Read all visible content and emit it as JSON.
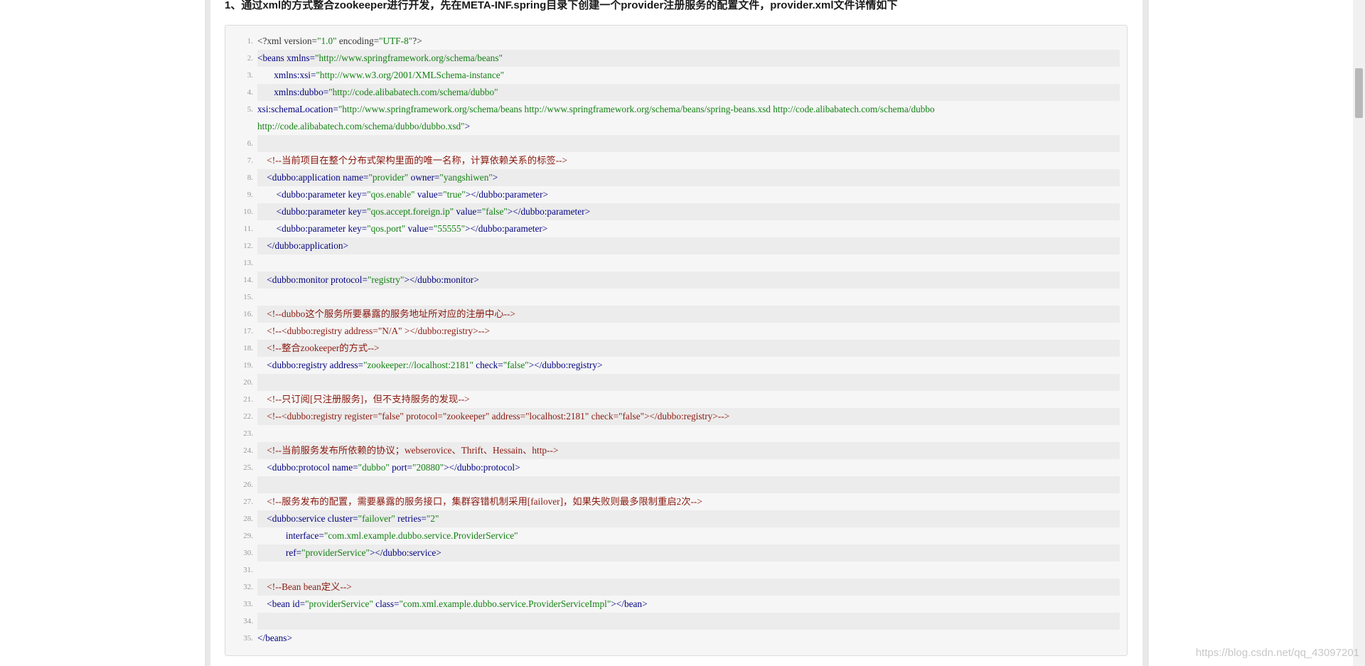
{
  "article": {
    "heading": "1、通过xml的方式整合zookeeper进行开发，先在META-INF.spring目录下创建一个provider注册服务的配置文件，provider.xml文件详情如下"
  },
  "code": {
    "lines": [
      {
        "n": "1.",
        "text": "<?xml version=\"1.0\" encoding=\"UTF-8\"?>",
        "type": "pi"
      },
      {
        "n": "2.",
        "text": "<beans xmlns=\"http://www.springframework.org/schema/beans\"",
        "type": "tag"
      },
      {
        "n": "3.",
        "text": "       xmlns:xsi=\"http://www.w3.org/2001/XMLSchema-instance\"",
        "type": "tag"
      },
      {
        "n": "4.",
        "text": "       xmlns:dubbo=\"http://code.alibabatech.com/schema/dubbo\"",
        "type": "tag"
      },
      {
        "n": "5.",
        "text": "       xsi:schemaLocation=\"http://www.springframework.org/schema/beans        http://www.springframework.org/schema/beans/spring-beans.xsd        http://code.alibabatech.com/schema/dubbo        http://code.alibabatech.com/schema/dubbo/dubbo.xsd\">",
        "type": "tag"
      },
      {
        "n": "6.",
        "text": "",
        "type": "tag"
      },
      {
        "n": "7.",
        "text": "    <!--当前项目在整个分布式架构里面的唯一名称，计算依赖关系的标签-->",
        "type": "com"
      },
      {
        "n": "8.",
        "text": "    <dubbo:application name=\"provider\" owner=\"yangshiwen\">",
        "type": "tag"
      },
      {
        "n": "9.",
        "text": "        <dubbo:parameter key=\"qos.enable\" value=\"true\"></dubbo:parameter>",
        "type": "tag"
      },
      {
        "n": "10.",
        "text": "        <dubbo:parameter key=\"qos.accept.foreign.ip\" value=\"false\"></dubbo:parameter>",
        "type": "tag"
      },
      {
        "n": "11.",
        "text": "        <dubbo:parameter key=\"qos.port\" value=\"55555\"></dubbo:parameter>",
        "type": "tag"
      },
      {
        "n": "12.",
        "text": "    </dubbo:application>",
        "type": "tag"
      },
      {
        "n": "13.",
        "text": "",
        "type": "tag"
      },
      {
        "n": "14.",
        "text": "    <dubbo:monitor protocol=\"registry\"></dubbo:monitor>",
        "type": "tag"
      },
      {
        "n": "15.",
        "text": "",
        "type": "tag"
      },
      {
        "n": "16.",
        "text": "    <!--dubbo这个服务所要暴露的服务地址所对应的注册中心-->",
        "type": "com"
      },
      {
        "n": "17.",
        "text": "    <!--<dubbo:registry address=\"N/A\" ></dubbo:registry>-->",
        "type": "com"
      },
      {
        "n": "18.",
        "text": "    <!--整合zookeeper的方式-->",
        "type": "com"
      },
      {
        "n": "19.",
        "text": "    <dubbo:registry address=\"zookeeper://localhost:2181\" check=\"false\"></dubbo:registry>",
        "type": "tag"
      },
      {
        "n": "20.",
        "text": "",
        "type": "tag"
      },
      {
        "n": "21.",
        "text": "    <!--只订阅[只注册服务]，但不支持服务的发现-->",
        "type": "com"
      },
      {
        "n": "22.",
        "text": "    <!--<dubbo:registry register=\"false\" protocol=\"zookeeper\" address=\"localhost:2181\" check=\"false\"></dubbo:registry>-->",
        "type": "com"
      },
      {
        "n": "23.",
        "text": "",
        "type": "tag"
      },
      {
        "n": "24.",
        "text": "    <!--当前服务发布所依赖的协议；webserovice、Thrift、Hessain、http-->",
        "type": "com"
      },
      {
        "n": "25.",
        "text": "    <dubbo:protocol name=\"dubbo\" port=\"20880\"></dubbo:protocol>",
        "type": "tag"
      },
      {
        "n": "26.",
        "text": "",
        "type": "tag"
      },
      {
        "n": "27.",
        "text": "    <!--服务发布的配置，需要暴露的服务接口，集群容错机制采用[failover]，如果失败则最多限制重启2次-->",
        "type": "com"
      },
      {
        "n": "28.",
        "text": "    <dubbo:service cluster=\"failover\" retries=\"2\"",
        "type": "tag"
      },
      {
        "n": "29.",
        "text": "            interface=\"com.xml.example.dubbo.service.ProviderService\"",
        "type": "tag"
      },
      {
        "n": "30.",
        "text": "            ref=\"providerService\"></dubbo:service>",
        "type": "tag"
      },
      {
        "n": "31.",
        "text": "",
        "type": "tag"
      },
      {
        "n": "32.",
        "text": "    <!--Bean bean定义-->",
        "type": "com"
      },
      {
        "n": "33.",
        "text": "    <bean id=\"providerService\" class=\"com.xml.example.dubbo.service.ProviderServiceImpl\"></bean>",
        "type": "tag"
      },
      {
        "n": "34.",
        "text": "",
        "type": "tag"
      },
      {
        "n": "35.",
        "text": "</beans>",
        "type": "tag"
      }
    ]
  },
  "watermark": "https://blog.csdn.net/qq_43097201",
  "colors": {
    "tag": "#000080",
    "string": "#138013",
    "comment": "#8b1a10",
    "line_number": "#999999",
    "code_background": "#f6f6f6",
    "alt_row": "#ececec"
  }
}
